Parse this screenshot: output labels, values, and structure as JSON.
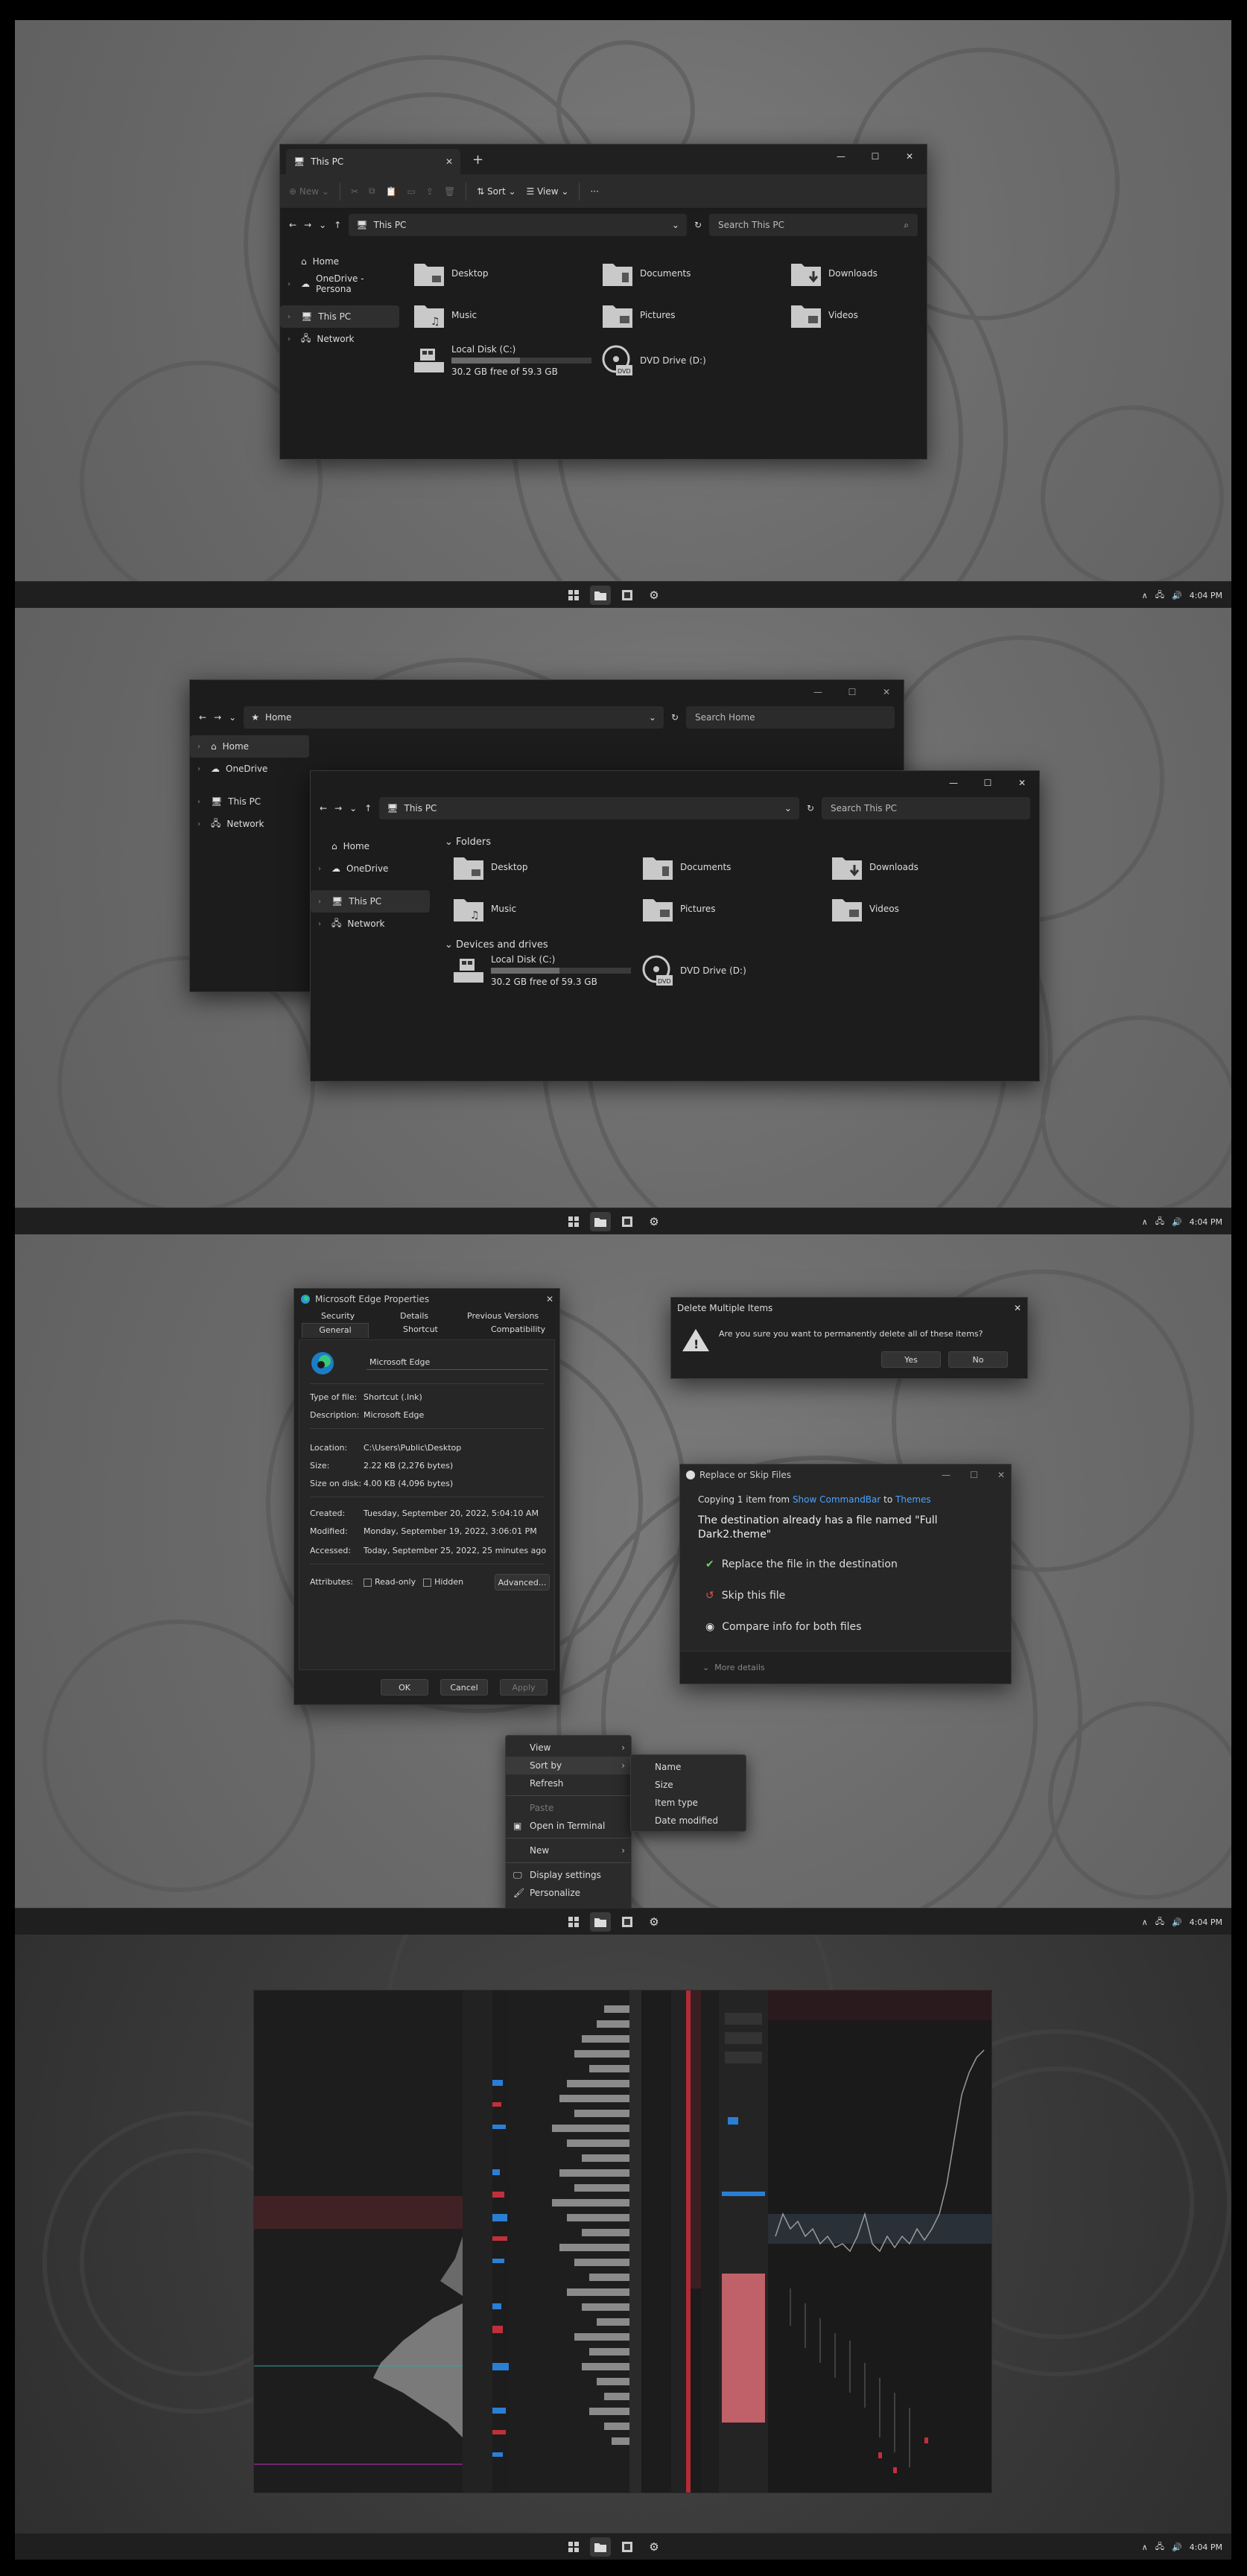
{
  "taskbar": {
    "time": "4:04 PM"
  },
  "explorer1": {
    "tab_title": "This PC",
    "toolbar": {
      "new_label": "New",
      "sort_label": "Sort",
      "view_label": "View",
      "more_label": "···"
    },
    "address": "This PC",
    "search_placeholder": "Search This PC",
    "nav": [
      "Home",
      "OneDrive - Persona",
      "This PC",
      "Network"
    ],
    "folders": [
      "Desktop",
      "Documents",
      "Downloads",
      "Music",
      "Pictures",
      "Videos"
    ],
    "drives": [
      {
        "name": "Local Disk (C:)",
        "free": "30.2 GB free of 59.3 GB",
        "used_fraction": 0.49
      },
      {
        "name": "DVD Drive (D:)"
      }
    ]
  },
  "explorer_back": {
    "address": "Home",
    "search_placeholder": "Search Home",
    "nav": [
      "Home",
      "OneDrive",
      "This PC",
      "Network"
    ]
  },
  "explorer_front": {
    "address": "This PC",
    "search_placeholder": "Search This PC",
    "nav": [
      "Home",
      "OneDrive",
      "This PC",
      "Network"
    ],
    "section_folders": "Folders",
    "section_drives": "Devices and drives",
    "folders": [
      "Desktop",
      "Documents",
      "Downloads",
      "Music",
      "Pictures",
      "Videos"
    ],
    "drives": [
      {
        "name": "Local Disk (C:)",
        "free": "30.2 GB free of 59.3 GB",
        "used_fraction": 0.49
      },
      {
        "name": "DVD Drive (D:)"
      }
    ]
  },
  "properties": {
    "title": "Microsoft Edge Properties",
    "tabs_top": [
      "Security",
      "Details",
      "Previous Versions"
    ],
    "tabs_bottom": [
      "General",
      "Shortcut",
      "Compatibility"
    ],
    "name_value": "Microsoft Edge",
    "rows1": [
      {
        "k": "Type of file:",
        "v": "Shortcut (.lnk)"
      },
      {
        "k": "Description:",
        "v": "Microsoft Edge"
      }
    ],
    "rows2": [
      {
        "k": "Location:",
        "v": "C:\\Users\\Public\\Desktop"
      },
      {
        "k": "Size:",
        "v": "2.22 KB (2,276 bytes)"
      },
      {
        "k": "Size on disk:",
        "v": "4.00 KB (4,096 bytes)"
      }
    ],
    "rows3": [
      {
        "k": "Created:",
        "v": "Tuesday, September 20, 2022, 5:04:10 AM"
      },
      {
        "k": "Modified:",
        "v": "Monday, September 19, 2022, 3:06:01 PM"
      },
      {
        "k": "Accessed:",
        "v": "Today, September 25, 2022, 25 minutes ago"
      }
    ],
    "attributes_label": "Attributes:",
    "readonly_label": "Read-only",
    "hidden_label": "Hidden",
    "advanced_label": "Advanced...",
    "ok_label": "OK",
    "cancel_label": "Cancel",
    "apply_label": "Apply"
  },
  "delete_dialog": {
    "title": "Delete Multiple Items",
    "message": "Are you sure you want to permanently delete all of these items?",
    "yes_label": "Yes",
    "no_label": "No"
  },
  "replace_dialog": {
    "title": "Replace or Skip Files",
    "copying_prefix": "Copying 1 item from ",
    "from": "Show CommandBar",
    "to_word": " to ",
    "to": "Themes",
    "heading": "The destination already has a file named \"Full Dark2.theme\"",
    "options": [
      "Replace the file in the destination",
      "Skip this file",
      "Compare info for both files"
    ],
    "more_details": "More details"
  },
  "context_menu": {
    "items": [
      "View",
      "Sort by",
      "Refresh",
      "Paste",
      "Open in Terminal",
      "New",
      "Display settings",
      "Personalize"
    ],
    "submenu": [
      "Name",
      "Size",
      "Item type",
      "Date modified"
    ]
  },
  "colors": {
    "accent": "#4aa3ff",
    "sell": "#c0303a",
    "buy": "#2a7fd4"
  }
}
